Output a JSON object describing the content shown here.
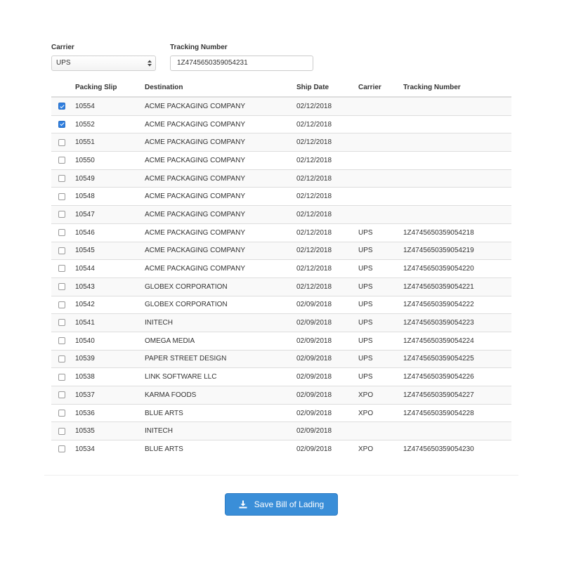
{
  "form": {
    "carrier_label": "Carrier",
    "carrier_value": "UPS",
    "tracking_label": "Tracking Number",
    "tracking_value": "1Z4745650359054231"
  },
  "table": {
    "headers": [
      "Packing Slip",
      "Destination",
      "Ship Date",
      "Carrier",
      "Tracking Number"
    ],
    "rows": [
      {
        "checked": true,
        "slip": "10554",
        "destination": "ACME PACKAGING COMPANY",
        "ship_date": "02/12/2018",
        "carrier": "",
        "tracking": ""
      },
      {
        "checked": true,
        "slip": "10552",
        "destination": "ACME PACKAGING COMPANY",
        "ship_date": "02/12/2018",
        "carrier": "",
        "tracking": ""
      },
      {
        "checked": false,
        "slip": "10551",
        "destination": "ACME PACKAGING COMPANY",
        "ship_date": "02/12/2018",
        "carrier": "",
        "tracking": ""
      },
      {
        "checked": false,
        "slip": "10550",
        "destination": "ACME PACKAGING COMPANY",
        "ship_date": "02/12/2018",
        "carrier": "",
        "tracking": ""
      },
      {
        "checked": false,
        "slip": "10549",
        "destination": "ACME PACKAGING COMPANY",
        "ship_date": "02/12/2018",
        "carrier": "",
        "tracking": ""
      },
      {
        "checked": false,
        "slip": "10548",
        "destination": "ACME PACKAGING COMPANY",
        "ship_date": "02/12/2018",
        "carrier": "",
        "tracking": ""
      },
      {
        "checked": false,
        "slip": "10547",
        "destination": "ACME PACKAGING COMPANY",
        "ship_date": "02/12/2018",
        "carrier": "",
        "tracking": ""
      },
      {
        "checked": false,
        "slip": "10546",
        "destination": "ACME PACKAGING COMPANY",
        "ship_date": "02/12/2018",
        "carrier": "UPS",
        "tracking": "1Z4745650359054218"
      },
      {
        "checked": false,
        "slip": "10545",
        "destination": "ACME PACKAGING COMPANY",
        "ship_date": "02/12/2018",
        "carrier": "UPS",
        "tracking": "1Z4745650359054219"
      },
      {
        "checked": false,
        "slip": "10544",
        "destination": "ACME PACKAGING COMPANY",
        "ship_date": "02/12/2018",
        "carrier": "UPS",
        "tracking": "1Z4745650359054220"
      },
      {
        "checked": false,
        "slip": "10543",
        "destination": "GLOBEX CORPORATION",
        "ship_date": "02/12/2018",
        "carrier": "UPS",
        "tracking": "1Z4745650359054221"
      },
      {
        "checked": false,
        "slip": "10542",
        "destination": "GLOBEX CORPORATION",
        "ship_date": "02/09/2018",
        "carrier": "UPS",
        "tracking": "1Z4745650359054222"
      },
      {
        "checked": false,
        "slip": "10541",
        "destination": "INITECH",
        "ship_date": "02/09/2018",
        "carrier": "UPS",
        "tracking": "1Z4745650359054223"
      },
      {
        "checked": false,
        "slip": "10540",
        "destination": "OMEGA MEDIA",
        "ship_date": "02/09/2018",
        "carrier": "UPS",
        "tracking": "1Z4745650359054224"
      },
      {
        "checked": false,
        "slip": "10539",
        "destination": "PAPER STREET DESIGN",
        "ship_date": "02/09/2018",
        "carrier": "UPS",
        "tracking": "1Z4745650359054225"
      },
      {
        "checked": false,
        "slip": "10538",
        "destination": "LINK SOFTWARE LLC",
        "ship_date": "02/09/2018",
        "carrier": "UPS",
        "tracking": "1Z4745650359054226"
      },
      {
        "checked": false,
        "slip": "10537",
        "destination": "KARMA FOODS",
        "ship_date": "02/09/2018",
        "carrier": "XPO",
        "tracking": "1Z4745650359054227"
      },
      {
        "checked": false,
        "slip": "10536",
        "destination": "BLUE ARTS",
        "ship_date": "02/09/2018",
        "carrier": "XPO",
        "tracking": "1Z4745650359054228"
      },
      {
        "checked": false,
        "slip": "10535",
        "destination": "INITECH",
        "ship_date": "02/09/2018",
        "carrier": "",
        "tracking": ""
      },
      {
        "checked": false,
        "slip": "10534",
        "destination": "BLUE ARTS",
        "ship_date": "02/09/2018",
        "carrier": "XPO",
        "tracking": "1Z4745650359054230"
      }
    ]
  },
  "actions": {
    "save_label": "Save Bill of Lading",
    "save_icon": "download-icon"
  },
  "colors": {
    "primary_button": "#3a8ed8",
    "checkbox_checked": "#2f7fe0",
    "row_stripe": "#f9f9f9"
  }
}
